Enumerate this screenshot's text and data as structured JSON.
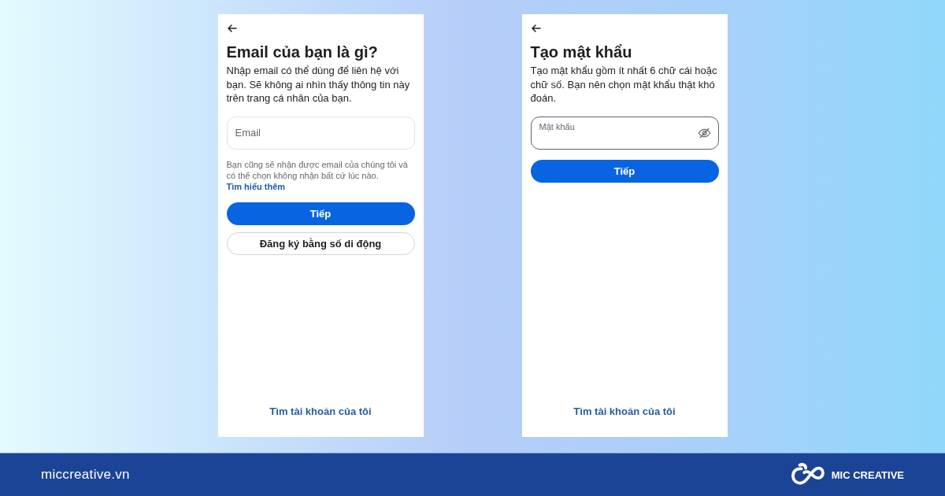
{
  "screens": [
    {
      "title": "Email của bạn là gì?",
      "description": "Nhập email có thể dùng để liên hệ với bạn. Sẽ không ai nhìn thấy thông tin này trên trang cá nhân của bạn.",
      "field": {
        "kind": "email",
        "placeholder": "Email",
        "focused": false
      },
      "helper": {
        "text": "Bạn cũng sẽ nhận được email của chúng tôi và có thể chọn không nhận bất cứ lúc nào.",
        "link": "Tìm hiểu thêm"
      },
      "buttons": [
        {
          "label": "Tiếp",
          "kind": "primary"
        },
        {
          "label": "Đăng ký bằng số di động",
          "kind": "secondary"
        }
      ],
      "footer_link": "Tìm tài khoản của tôi"
    },
    {
      "title": "Tạo mật khẩu",
      "description": "Tạo mật khẩu gồm ít nhất 6 chữ cái hoặc chữ số. Bạn nên chọn mật khẩu thật khó đoán.",
      "field": {
        "kind": "password",
        "label": "Mật khẩu",
        "focused": true
      },
      "buttons": [
        {
          "label": "Tiếp",
          "kind": "primary"
        }
      ],
      "footer_link": "Tìm tài khoản của tôi"
    }
  ],
  "footer": {
    "website": "miccreative.vn",
    "brand": "MIC CREATIVE"
  }
}
